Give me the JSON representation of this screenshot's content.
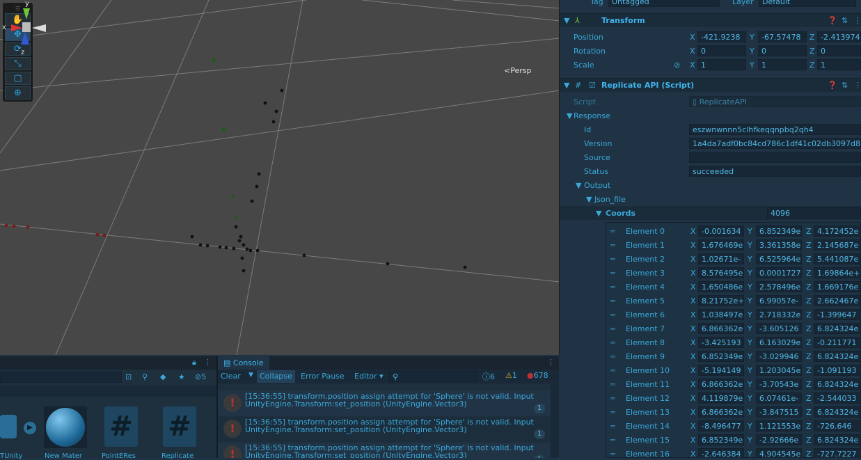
{
  "colors": {
    "accent": "#3aa8d8",
    "panel": "#1f3344",
    "scene": "#474747",
    "error": "#b33333"
  },
  "scene": {
    "persp_label": "<Persp",
    "axis_x": "x",
    "axis_y": "y",
    "axis_z": "z"
  },
  "inspector": {
    "tag_label": "Tag",
    "tag_value": "Untagged",
    "layer_label": "Layer",
    "layer_value": "Default",
    "transform": {
      "title": "Transform",
      "position": {
        "label": "Position",
        "x": "-421.9238",
        "y": "-67.57478",
        "z": "-2.413974"
      },
      "rotation": {
        "label": "Rotation",
        "x": "0",
        "y": "0",
        "z": "0"
      },
      "scale": {
        "label": "Scale",
        "x": "1",
        "y": "1",
        "z": "1"
      }
    },
    "script_comp": {
      "title": "Replicate API (Script)",
      "script_label": "Script",
      "script_value": "ReplicateAPI",
      "response_label": "Response",
      "id_label": "Id",
      "id_value": "eszwnwnnn5clhfkeqqnpbq2qh4",
      "version_label": "Version",
      "version_value": "1a4da7adf0bc84cd786c1df41c02db3097d8",
      "source_label": "Source",
      "source_value": "",
      "status_label": "Status",
      "status_value": "succeeded",
      "output_label": "Output",
      "json_file_label": "Json_file",
      "coords_label": "Coords",
      "coords_count": "4096"
    },
    "elements": [
      {
        "label": "Element 0",
        "x": "-0.001634",
        "y": "6.852349e",
        "z": "4.172452e"
      },
      {
        "label": "Element 1",
        "x": "1.676469e",
        "y": "3.361358e",
        "z": "2.145687e"
      },
      {
        "label": "Element 2",
        "x": "1.02671e-",
        "y": "6.525964e",
        "z": "5.441087e"
      },
      {
        "label": "Element 3",
        "x": "8.576495e",
        "y": "0.0001727",
        "z": "1.69864e+"
      },
      {
        "label": "Element 4",
        "x": "1.650486e",
        "y": "2.578496e",
        "z": "1.669176e"
      },
      {
        "label": "Element 5",
        "x": "8.21752e+",
        "y": "6.99057e-",
        "z": "2.662467e"
      },
      {
        "label": "Element 6",
        "x": "1.038497e",
        "y": "2.718332e",
        "z": "-1.399647"
      },
      {
        "label": "Element 7",
        "x": "6.866362e",
        "y": "-3.605126",
        "z": "6.824324e"
      },
      {
        "label": "Element 8",
        "x": "-3.425193",
        "y": "6.163029e",
        "z": "-0.211771"
      },
      {
        "label": "Element 9",
        "x": "6.852349e",
        "y": "-3.029946",
        "z": "6.824324e"
      },
      {
        "label": "Element 10",
        "x": "-5.194149",
        "y": "1.203045e",
        "z": "-1.091193"
      },
      {
        "label": "Element 11",
        "x": "6.866362e",
        "y": "-3.70543e",
        "z": "6.824324e"
      },
      {
        "label": "Element 12",
        "x": "4.119879e",
        "y": "6.07461e-",
        "z": "-2.544033"
      },
      {
        "label": "Element 13",
        "x": "6.866362e",
        "y": "-3.847515",
        "z": "6.824324e"
      },
      {
        "label": "Element 14",
        "x": "-8.496477",
        "y": "1.121553e",
        "z": "-726.646"
      },
      {
        "label": "Element 15",
        "x": "6.852349e",
        "y": "-2.92666e",
        "z": "6.824324e"
      },
      {
        "label": "Element 16",
        "x": "-2.646384",
        "y": "4.904545e",
        "z": "-727.7227"
      }
    ]
  },
  "project": {
    "hidden_count": "5",
    "assets": [
      {
        "label": "TUnity"
      },
      {
        "label": "New Mater"
      },
      {
        "label": "PointERes"
      },
      {
        "label": "Replicate"
      }
    ]
  },
  "console": {
    "tab_label": "Console",
    "clear": "Clear",
    "collapse": "Collapse",
    "error_pause": "Error Pause",
    "editor": "Editor",
    "info_count": "6",
    "warn_count": "1",
    "error_count": "678",
    "messages": [
      {
        "line1": "[15:36:55] transform.position assign attempt for 'Sphere' is not valid. Input",
        "line2": "UnityEngine.Transform:set_position (UnityEngine.Vector3)",
        "count": "1"
      },
      {
        "line1": "[15:36:55] transform.position assign attempt for 'Sphere' is not valid. Input",
        "line2": "UnityEngine.Transform:set_position (UnityEngine.Vector3)",
        "count": "1"
      },
      {
        "line1": "[15:36:55] transform.position assign attempt for 'Sphere' is not valid. Input",
        "line2": "UnityEngine.Transform:set_position (UnityEngine.Vector3)",
        "count": "1"
      }
    ]
  }
}
